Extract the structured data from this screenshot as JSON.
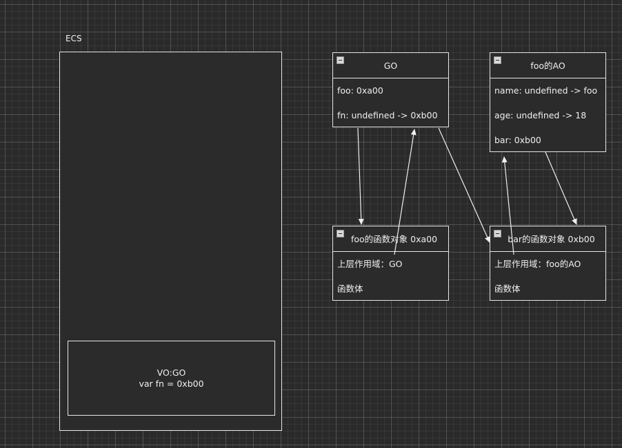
{
  "ecs": {
    "label": "ECS",
    "vo": {
      "line1": "VO:GO",
      "line2": "var fn =  0xb00"
    }
  },
  "go": {
    "title": "GO",
    "rows": [
      "foo: 0xa00",
      "fn: undefined -> 0xb00"
    ]
  },
  "foo_ao": {
    "title": "foo的AO",
    "rows": [
      "name: undefined  -> foo",
      "age: undefined -> 18",
      "bar: 0xb00"
    ]
  },
  "foo_func": {
    "title": "foo的函数对象 0xa00",
    "rows": [
      "上层作用域：GO",
      "函数体"
    ]
  },
  "bar_func": {
    "title": "bar的函数对象 0xb00",
    "rows": [
      "上层作用域：foo的AO",
      "函数体"
    ]
  },
  "colors": {
    "background": "#2a2a2a",
    "stroke": "#e8e8e8",
    "text": "#f0f0f0"
  },
  "icons": [
    "collapse-icon"
  ]
}
